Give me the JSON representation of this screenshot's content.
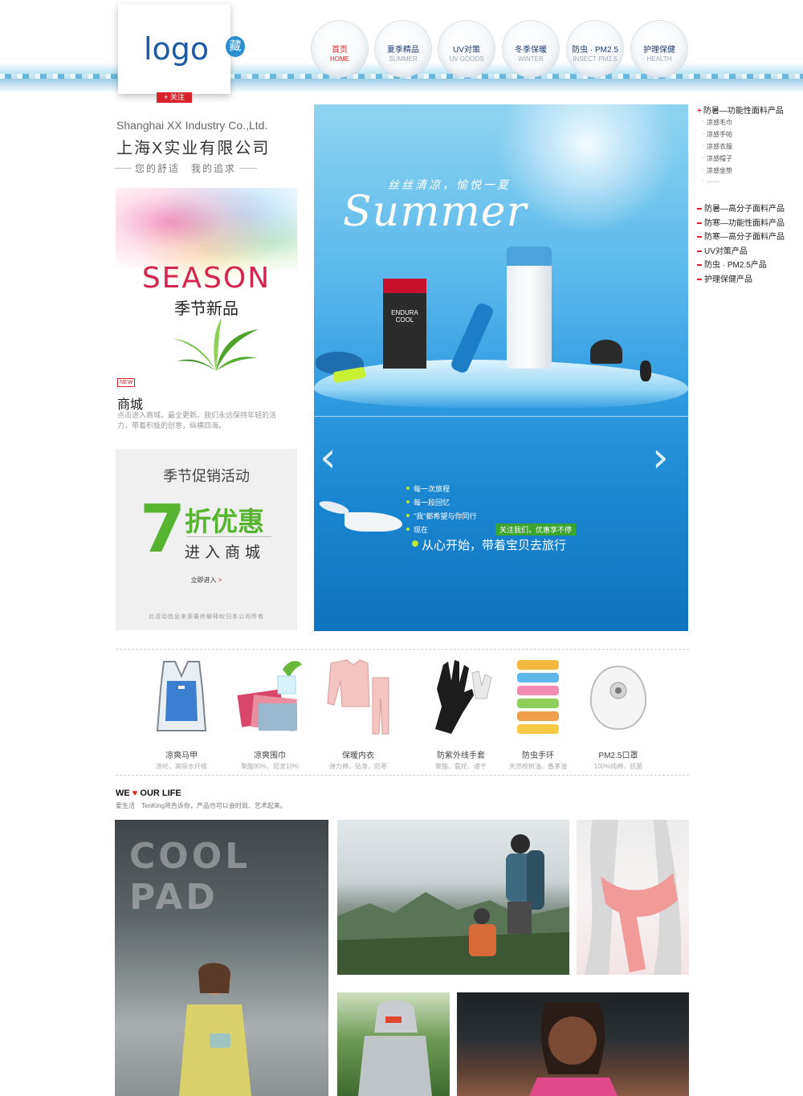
{
  "header": {
    "logo": "logo",
    "collect_badge": "藏",
    "follow_button": "+ 关注",
    "nav": [
      {
        "cn": "首页",
        "en": "HOME",
        "active": true
      },
      {
        "cn": "夏季精品",
        "en": "SUMMER",
        "active": false
      },
      {
        "cn": "UV对策",
        "en": "UV GOODS",
        "active": false
      },
      {
        "cn": "冬季保暖",
        "en": "WINTER",
        "active": false
      },
      {
        "cn": "防虫 · PM2.5",
        "en": "INSECT·PM2.5",
        "active": false
      },
      {
        "cn": "护理保健",
        "en": "HEALTH",
        "active": false
      }
    ]
  },
  "company": {
    "name_en": "Shanghai XX Industry Co.,Ltd.",
    "name_cn": "上海X实业有限公司",
    "slogan": "您的舒适　我的追求"
  },
  "season_banner": {
    "word": "SEASON",
    "subtitle": "季节新品"
  },
  "mall": {
    "badge": "NEW",
    "title": "商城",
    "description": "点击进入商城，最全更新。我们永远保持年轻的活力，带着积极的创意，纵横四海。"
  },
  "promo": {
    "title": "季节促销活动",
    "number": "7",
    "discount": "折优惠",
    "enter": "进入商城",
    "link": "立即进入",
    "link_arrow": ">",
    "note": "此活动信息来源最终解释权归本公司所有"
  },
  "hero": {
    "tagline": "丝丝清凉，愉悦一夏",
    "summer": "Summer",
    "box_label": "ENDURA COOL",
    "lines": [
      "每一次旅程",
      "每一段回忆",
      "\"我\"都希望与你同行",
      "现在"
    ],
    "main": "从心开始，带着宝贝去旅行",
    "follow_tag": "关注我们，优惠享不停",
    "arrow_left": "‹",
    "arrow_right": "›"
  },
  "sidebar": {
    "head_mark": "+",
    "head": "防暑—功能性面料产品",
    "sub_items": [
      "凉感毛巾",
      "凉感手帕",
      "凉感衣服",
      "凉感帽子",
      "凉感坐垫",
      "……"
    ],
    "categories": [
      "防暑—高分子面料产品",
      "防寒—功能性面料产品",
      "防寒—高分子面料产品",
      "UV对策产品",
      "防虫 · PM2.5产品",
      "护理保健产品"
    ]
  },
  "products": [
    {
      "name": "凉爽马甲",
      "desc": "涤纶、高吸水纤维",
      "icon": "vest-icon"
    },
    {
      "name": "凉爽围巾",
      "desc": "聚酯90%、尼龙10%",
      "icon": "scarf-icon"
    },
    {
      "name": "保暖内衣",
      "desc": "弹力棉，贴身，防寒",
      "icon": "thermal-underwear-icon"
    },
    {
      "name": "防紫外线手套",
      "desc": "聚酯、氨纶、速干",
      "icon": "gloves-icon"
    },
    {
      "name": "防虫手环",
      "desc": "天然桉树油、香茅油",
      "icon": "bracelet-icon"
    },
    {
      "name": "PM2.5口罩",
      "desc": "100%纯棉，抗菌",
      "icon": "mask-icon"
    }
  ],
  "life": {
    "title_we": "WE",
    "title_heart": "♥",
    "title_rest": "OUR LIFE",
    "subtitle": "爱生活　TenKing将告诉你，产品也可以会时尚、艺术起来。",
    "coolpad": "COOL PAD"
  },
  "colors": {
    "accent_red": "#d9232a",
    "promo_green": "#57b431",
    "nav_blue": "#1e3a6e",
    "hero_blue": "#2f9be0"
  }
}
